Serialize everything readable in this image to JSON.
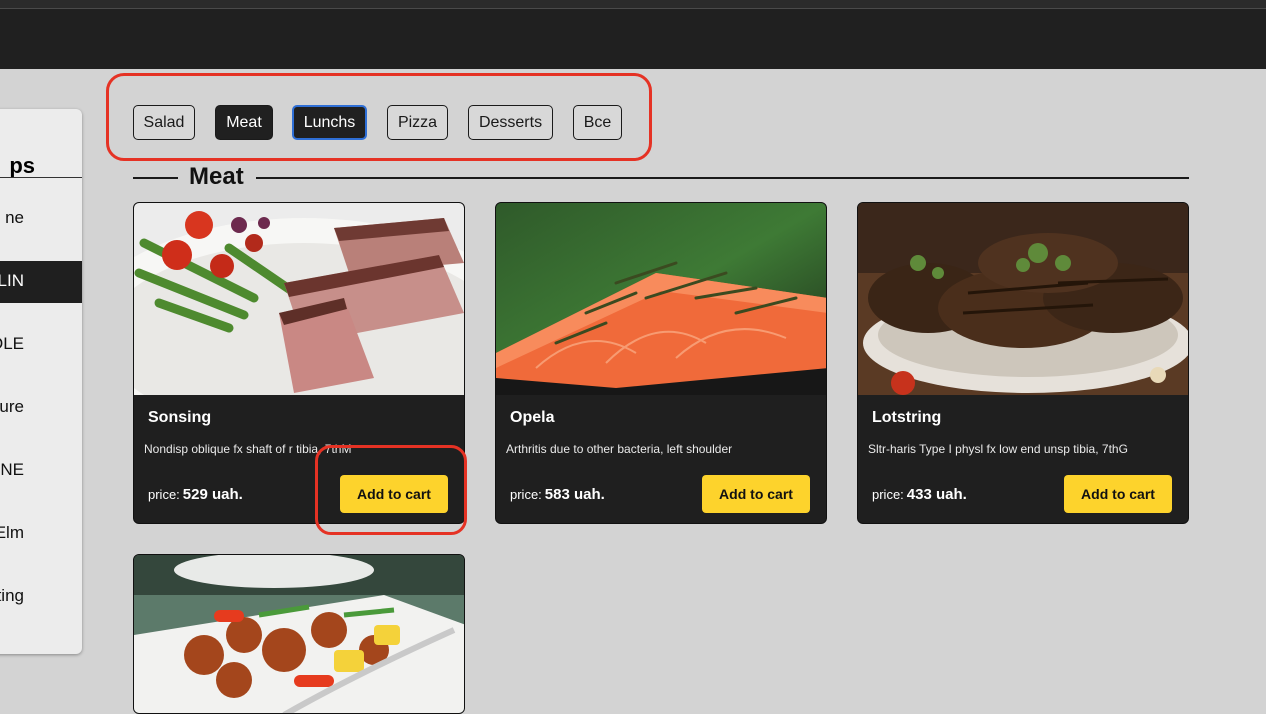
{
  "sidebar": {
    "title": "ps",
    "items": [
      {
        "label": "ne"
      },
      {
        "label": "LLIN"
      },
      {
        "label": "AZOLE"
      },
      {
        "label": "ture"
      },
      {
        "label": "ONE"
      },
      {
        "label": "Elm"
      },
      {
        "label": "drating"
      }
    ]
  },
  "filters": [
    {
      "label": "Salad"
    },
    {
      "label": "Meat"
    },
    {
      "label": "Lunchs"
    },
    {
      "label": "Pizza"
    },
    {
      "label": "Desserts"
    },
    {
      "label": "Bce"
    }
  ],
  "section": {
    "title": "Meat"
  },
  "products": [
    {
      "name": "Sonsing",
      "description": "Nondisp oblique fx shaft of r tibia, 7thM",
      "price_label": "price:",
      "price": "529 uah.",
      "button": "Add to cart"
    },
    {
      "name": "Opela",
      "description": "Arthritis due to other bacteria, left shoulder",
      "price_label": "price:",
      "price": "583 uah.",
      "button": "Add to cart"
    },
    {
      "name": "Lotstring",
      "description": "Sltr-haris Type I physl fx low end unsp tibia, 7thG",
      "price_label": "price:",
      "price": "433 uah.",
      "button": "Add to cart"
    }
  ],
  "colors": {
    "accent_button": "#fdd32c",
    "annotation": "#e53224",
    "card_bg": "#1f1f1f"
  }
}
